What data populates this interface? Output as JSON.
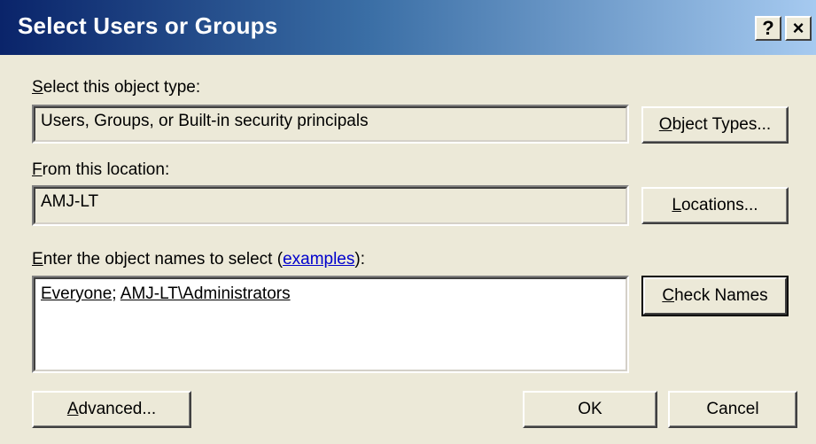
{
  "window": {
    "title": "Select Users or Groups",
    "help_glyph": "?",
    "close_glyph": "×"
  },
  "object_type": {
    "label_accel": "S",
    "label_rest": "elect this object type:",
    "value": "Users, Groups, or Built-in security principals",
    "button_accel": "O",
    "button_rest": "bject Types..."
  },
  "location": {
    "label_accel": "F",
    "label_rest": "rom this location:",
    "value": "AMJ-LT",
    "button_accel": "L",
    "button_rest": "ocations..."
  },
  "names": {
    "label_accel": "E",
    "label_rest": "nter the object names to select (",
    "examples_link": "examples",
    "label_end": "):",
    "entries": [
      "Everyone",
      "AMJ-LT\\Administrators"
    ],
    "separator": "; ",
    "check_accel": "C",
    "check_rest": "heck Names"
  },
  "footer": {
    "advanced_accel": "A",
    "advanced_rest": "dvanced...",
    "ok_label": "OK",
    "cancel_label": "Cancel"
  }
}
